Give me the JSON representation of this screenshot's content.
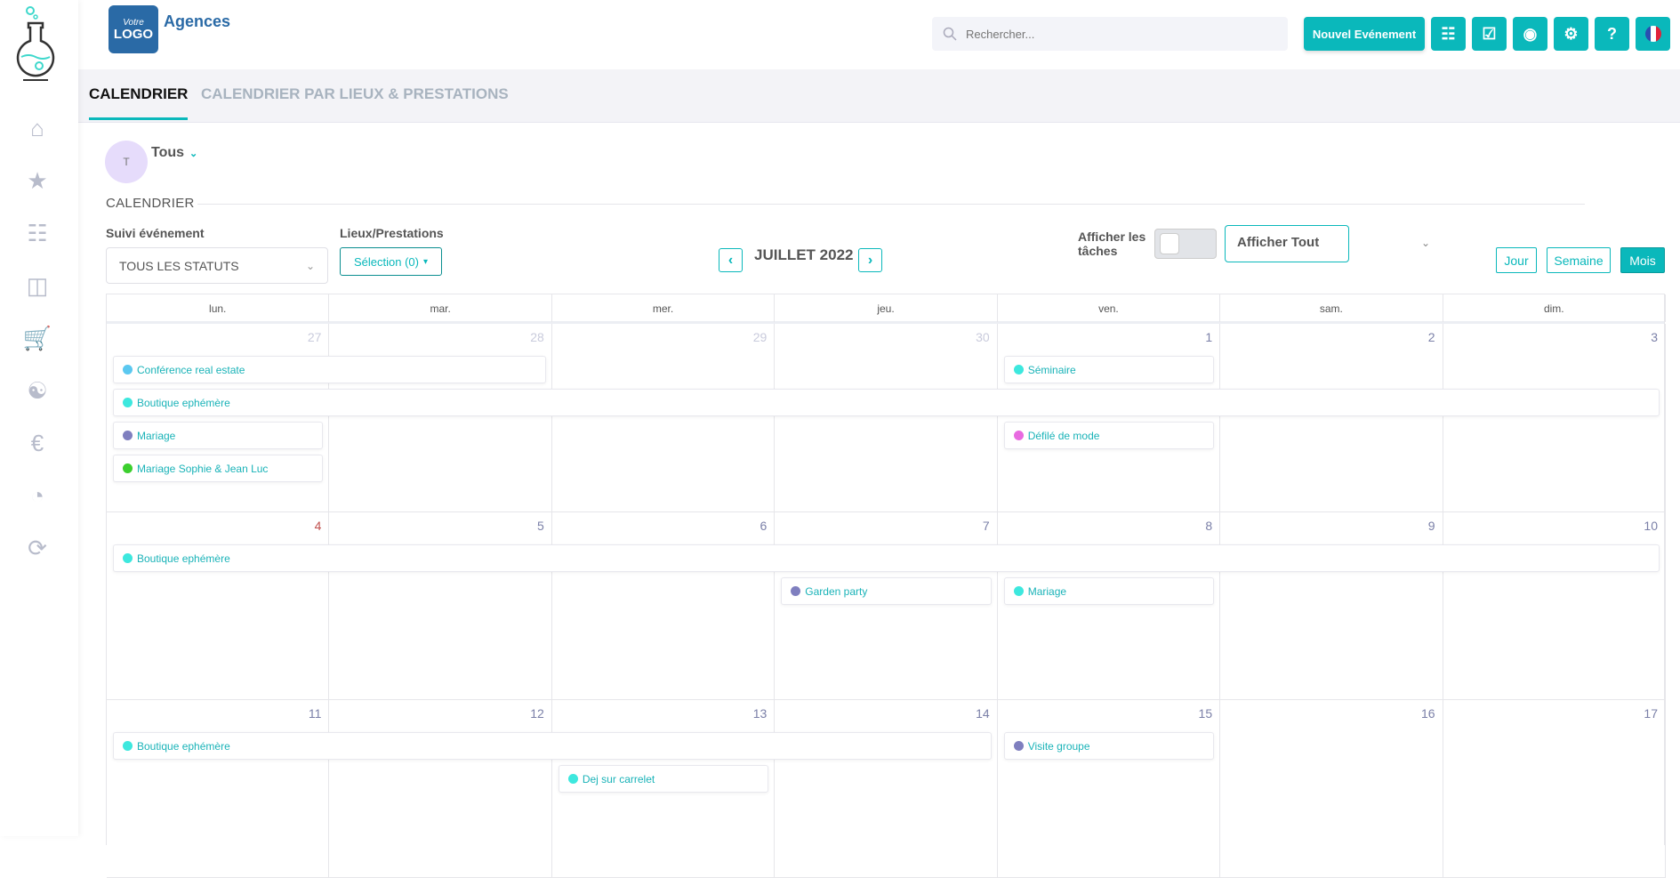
{
  "brand": {
    "logo_text": "Votre LOGO",
    "name": "Agences"
  },
  "header": {
    "search_placeholder": "Rechercher...",
    "new_event_label": "Nouvel Evénement",
    "accent": "#0ab8bb",
    "icons": [
      "calendar-icon",
      "clipboard-checklist-icon",
      "user-circle-icon",
      "gear-icon",
      "help-icon",
      "french-flag-icon"
    ]
  },
  "sidebar": {
    "items": [
      "home-icon",
      "team-rating-icon",
      "event-calendar-icon",
      "presentation-icon",
      "cart-icon",
      "handshake-icon",
      "euro-coins-icon",
      "pie-chart-icon",
      "sync-check-icon"
    ]
  },
  "tabs": [
    {
      "label": "CALENDRIER",
      "active": true
    },
    {
      "label": "CALENDRIER PAR LIEUX & PRESTATIONS",
      "active": false
    }
  ],
  "user": {
    "initial": "T",
    "name": "Tous"
  },
  "section_label": "CALENDRIER",
  "filters": {
    "status_label": "Suivi événement",
    "status_value": "TOUS LES STATUTS",
    "lieux_label": "Lieux/Prestations",
    "lieux_value": "Sélection (0)",
    "month": "JUILLET 2022",
    "tasks_label": "Afficher les tâches",
    "tasks_on": false,
    "display_value": "Afficher Tout",
    "views": [
      {
        "label": "Jour",
        "active": false
      },
      {
        "label": "Semaine",
        "active": false
      },
      {
        "label": "Mois",
        "active": true
      }
    ]
  },
  "calendar": {
    "weekdays": [
      "lun.",
      "mar.",
      "mer.",
      "jeu.",
      "ven.",
      "sam.",
      "dim."
    ],
    "weeks": [
      {
        "days": [
          {
            "n": "27",
            "muted": true
          },
          {
            "n": "28",
            "muted": true
          },
          {
            "n": "29",
            "muted": true
          },
          {
            "n": "30",
            "muted": true
          },
          {
            "n": "1"
          },
          {
            "n": "2"
          },
          {
            "n": "3"
          }
        ],
        "events": [
          {
            "label": "Conférence real estate",
            "color": "#5bc8f0",
            "start": "27",
            "end": "28"
          },
          {
            "label": "Boutique ephémère",
            "color": "#3de8de",
            "start": "27",
            "end": "3"
          },
          {
            "label": "Mariage",
            "color": "#7f7fbf",
            "start": "27",
            "end": "27"
          },
          {
            "label": "Mariage Sophie & Jean Luc",
            "color": "#3ccf2e",
            "start": "27",
            "end": "27"
          },
          {
            "label": "Séminaire",
            "color": "#3de8de",
            "start": "1",
            "end": "1"
          },
          {
            "label": "Défilé de mode",
            "color": "#e86ae0",
            "start": "1",
            "end": "1"
          }
        ]
      },
      {
        "days": [
          {
            "n": "4",
            "today": true
          },
          {
            "n": "5"
          },
          {
            "n": "6"
          },
          {
            "n": "7"
          },
          {
            "n": "8"
          },
          {
            "n": "9"
          },
          {
            "n": "10"
          }
        ],
        "events": [
          {
            "label": "Boutique ephémère",
            "color": "#3de8de",
            "start": "4",
            "end": "10"
          },
          {
            "label": "Garden party",
            "color": "#7f7fbf",
            "start": "7",
            "end": "7"
          },
          {
            "label": "Mariage",
            "color": "#3de8de",
            "start": "8",
            "end": "8"
          }
        ]
      },
      {
        "days": [
          {
            "n": "11"
          },
          {
            "n": "12"
          },
          {
            "n": "13"
          },
          {
            "n": "14"
          },
          {
            "n": "15"
          },
          {
            "n": "16"
          },
          {
            "n": "17"
          }
        ],
        "events": [
          {
            "label": "Boutique ephémère",
            "color": "#3de8de",
            "start": "11",
            "end": "14"
          },
          {
            "label": "Visite groupe",
            "color": "#7f7fbf",
            "start": "15",
            "end": "15"
          },
          {
            "label": "Dej sur carrelet",
            "color": "#3de8de",
            "start": "13",
            "end": "13"
          }
        ]
      }
    ]
  }
}
